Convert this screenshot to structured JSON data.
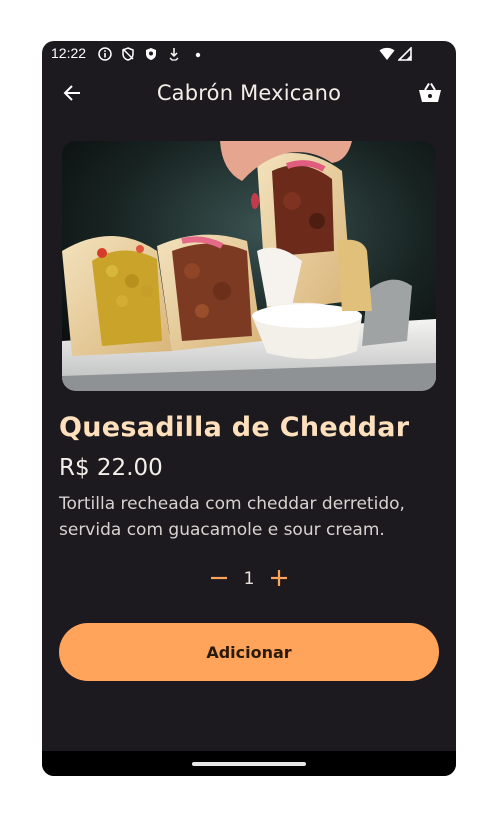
{
  "status_bar": {
    "time": "12:22"
  },
  "app_bar": {
    "title": "Cabrón Mexicano",
    "back_icon": "arrow-back-icon",
    "cart_icon": "basket-icon"
  },
  "product": {
    "name": "Quesadilla de Cheddar",
    "price": "R$ 22.00",
    "description": "Tortilla recheada com cheddar derretido, servida com guacamole e sour cream."
  },
  "quantity": {
    "value": "1",
    "minus_icon": "minus-icon",
    "plus_icon": "plus-icon"
  },
  "actions": {
    "add_label": "Adicionar"
  },
  "colors": {
    "background": "#1c1a1e",
    "accent": "#ffa45a",
    "title_text": "#ffe0bd"
  }
}
